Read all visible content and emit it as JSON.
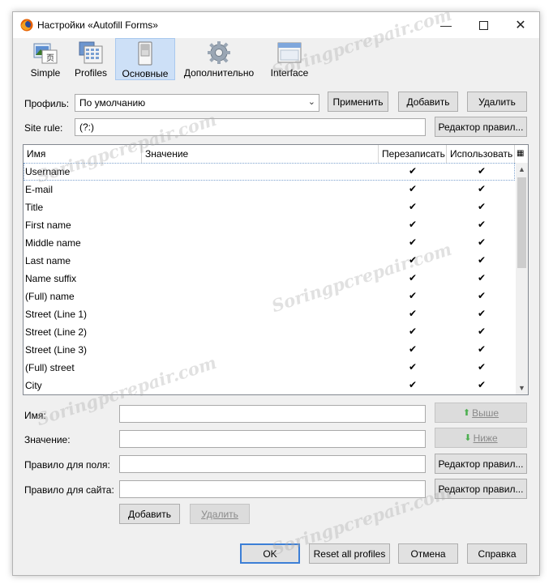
{
  "window": {
    "title": "Настройки «Autofill Forms»"
  },
  "toolbar": {
    "tabs": [
      {
        "label": "Simple",
        "icon": "simple-icon"
      },
      {
        "label": "Profiles",
        "icon": "profiles-icon"
      },
      {
        "label": "Основные",
        "icon": "main-icon",
        "active": true
      },
      {
        "label": "Дополнительно",
        "icon": "gear-icon"
      },
      {
        "label": "Interface",
        "icon": "window-icon"
      }
    ]
  },
  "profile": {
    "label": "Профиль:",
    "value": "По умолчанию",
    "apply": "Применить",
    "add": "Добавить",
    "delete": "Удалить"
  },
  "site_rule": {
    "label": "Site rule:",
    "value": "(?:)",
    "editor": "Редактор правил..."
  },
  "table": {
    "columns": [
      "Имя",
      "Значение",
      "Перезаписать",
      "Использовать"
    ],
    "rows": [
      {
        "name": "Username",
        "ow": "✔",
        "use": "✔"
      },
      {
        "name": "E-mail",
        "ow": "✔",
        "use": "✔"
      },
      {
        "name": "Title",
        "ow": "✔",
        "use": "✔"
      },
      {
        "name": "First name",
        "ow": "✔",
        "use": "✔"
      },
      {
        "name": "Middle name",
        "ow": "✔",
        "use": "✔"
      },
      {
        "name": "Last name",
        "ow": "✔",
        "use": "✔"
      },
      {
        "name": "Name suffix",
        "ow": "✔",
        "use": "✔"
      },
      {
        "name": "(Full) name",
        "ow": "✔",
        "use": "✔"
      },
      {
        "name": "Street (Line 1)",
        "ow": "✔",
        "use": "✔"
      },
      {
        "name": "Street (Line 2)",
        "ow": "✔",
        "use": "✔"
      },
      {
        "name": "Street (Line 3)",
        "ow": "✔",
        "use": "✔"
      },
      {
        "name": "(Full) street",
        "ow": "✔",
        "use": "✔"
      },
      {
        "name": "City",
        "ow": "✔",
        "use": "✔"
      }
    ]
  },
  "form": {
    "name_label": "Имя:",
    "value_label": "Значение:",
    "field_rule_label": "Правило для поля:",
    "site_rule_label": "Правило для сайта:",
    "up": "Выше",
    "down": "Ниже",
    "editor": "Редактор правил...",
    "add": "Добавить",
    "delete": "Удалить"
  },
  "footer": {
    "ok": "OK",
    "reset": "Reset all profiles",
    "cancel": "Отмена",
    "help": "Справка"
  },
  "watermark": "Soringpcrepair.com",
  "colors": {
    "accent": "#3c7fd6",
    "selected_tab": "#cde0f7"
  }
}
